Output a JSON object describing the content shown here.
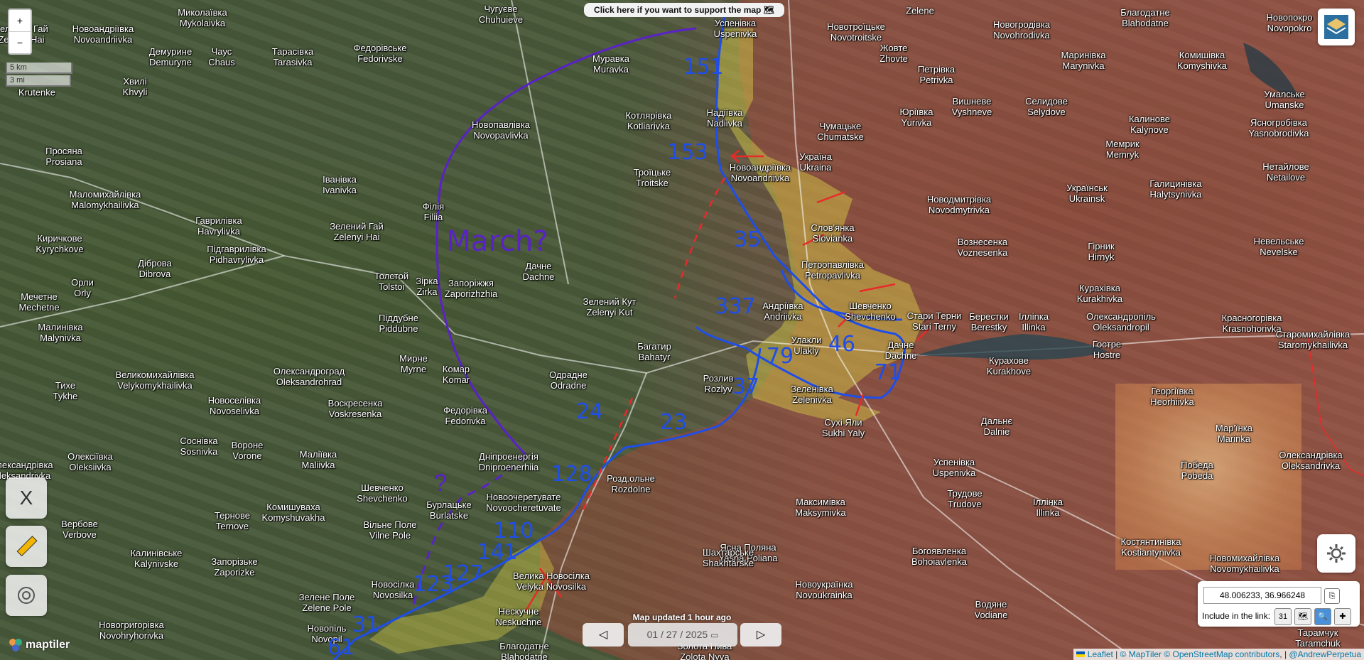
{
  "banner": {
    "support": "Click here if you want to support the map"
  },
  "zoom": {
    "in": "+",
    "out": "−"
  },
  "scale": {
    "km": "5 km",
    "mi": "3 mi"
  },
  "sidebar": {
    "x_label": "X"
  },
  "map": {
    "updated": "Map updated 1 hour ago",
    "date": "01 / 27 / 2025",
    "coordinates": "48.006233, 36.966248",
    "include_label": "Include in the link:",
    "calendar_day": "31"
  },
  "annotations": {
    "march": "March?",
    "question": "?",
    "units": [
      "151",
      "153",
      "35",
      "337",
      "79",
      "46",
      "71",
      "37",
      "23",
      "24",
      "128",
      "110",
      "141",
      "123",
      "127",
      "31",
      "61"
    ]
  },
  "attribution": {
    "leaflet": "Leaflet",
    "maptiler": "© MapTiler",
    "osm": "© OpenStreetMap contributors",
    "author": "@AndrewPerpetua",
    "logo": "maptiler"
  },
  "places": [
    [
      "Миколаївка\nMykolaivka",
      285,
      25
    ],
    [
      "Чугуєве\nChuhuieve",
      705,
      20
    ],
    [
      "Успенівка\nUspenivka",
      1035,
      40
    ],
    [
      "Новотроїцьке\nNovotroitske",
      1205,
      45
    ],
    [
      "Zelene",
      1295,
      15
    ],
    [
      "Новогродівка\nNovohrodivka",
      1438,
      42
    ],
    [
      "Благодатне\nBlahodatne",
      1612,
      25
    ],
    [
      "Новопокро\nNovopokro",
      1815,
      32
    ],
    [
      "Новоандріївка\nNovoandriivka",
      145,
      48
    ],
    [
      "Зелений Гай\nZelenyi Hai",
      30,
      48
    ],
    [
      "Демурине\nDemuryne",
      240,
      80
    ],
    [
      "Чаус\nChaus",
      312,
      80
    ],
    [
      "Тарасівка\nTarasivka",
      412,
      80
    ],
    [
      "Федорівське\nFedorivske",
      535,
      75
    ],
    [
      "Муравка\nMuravka",
      860,
      90
    ],
    [
      "Жовте\nZhovte",
      1258,
      75
    ],
    [
      "Маринівка\nMarynivka",
      1525,
      85
    ],
    [
      "Комишівка\nKomyshivka",
      1692,
      85
    ],
    [
      "Хвилі\nKhvyli",
      190,
      122
    ],
    [
      "Krutenke",
      52,
      130
    ],
    [
      "Петрівка\nPetrivka",
      1318,
      105
    ],
    [
      "Новопавлівка\nNovopavlivka",
      705,
      183
    ],
    [
      "Котлярівка\nKotliarivka",
      913,
      170
    ],
    [
      "Надіївка\nNadiivka",
      1020,
      166
    ],
    [
      "Вишневе\nVyshneve",
      1368,
      150
    ],
    [
      "Селидове\nSelydove",
      1473,
      150
    ],
    [
      "Юріївка\nYurivka",
      1290,
      165
    ],
    [
      "Калинове\nKalynove",
      1618,
      175
    ],
    [
      "Умanське\nUmanske",
      1808,
      140
    ],
    [
      "Ясногробівка\nYasnobrodivka",
      1800,
      180
    ],
    [
      "Просяна\nProsiana",
      90,
      220
    ],
    [
      "Чумацьке\nChumatske",
      1183,
      185
    ],
    [
      "Україна\nUkraina",
      1148,
      228
    ],
    [
      "Новоандріївка\nNovoandriivka",
      1070,
      243
    ],
    [
      "Троїцьке\nTroitske",
      918,
      250
    ],
    [
      "Мемрик\nMemryk",
      1580,
      210
    ],
    [
      "Маломихайлівка\nMalomykhailivka",
      148,
      281
    ],
    [
      "Іванівка\nIvanivka",
      478,
      260
    ],
    [
      "Гаврилівка\nHavrylivka",
      308,
      318
    ],
    [
      "Філія\nFiliia",
      610,
      298
    ],
    [
      "Українськ\nUkrainsk",
      1530,
      272
    ],
    [
      "Галицинівка\nHalytsynivka",
      1655,
      266
    ],
    [
      "Нетайлове\nNetailove",
      1810,
      242
    ],
    [
      "Новодмитрівка\nNovodmytrivka",
      1350,
      288
    ],
    [
      "Киричкове\nKyrychkove",
      84,
      343
    ],
    [
      "Зелений Гай\nZelenyi Hai",
      502,
      326
    ],
    [
      "Підгаврилівка\nPidhavrylivka",
      333,
      358
    ],
    [
      "Слов'янка\nSlovianka",
      1172,
      328
    ],
    [
      "Вознесенка\nVoznesenka",
      1383,
      348
    ],
    [
      "Гірник\nHirnyk",
      1550,
      354
    ],
    [
      "Невельське\nNevelske",
      1800,
      347
    ],
    [
      "Діброва\nDibrova",
      218,
      378
    ],
    [
      "Дачне\nDachne",
      758,
      382
    ],
    [
      "Петропавлівка\nPetropavlivka",
      1172,
      380
    ],
    [
      "Орли\nOrly",
      116,
      405
    ],
    [
      "Толстой\nTolstoi",
      551,
      396
    ],
    [
      "Зірка\nZirka",
      601,
      403
    ],
    [
      "Запоріжжя\nZaporizhzhia",
      663,
      406
    ],
    [
      "Зелений Кут\nZelenyi Kut",
      858,
      432
    ],
    [
      "Андріївка\nAndriivka",
      1102,
      438
    ],
    [
      "Шевченко\nShevchenko",
      1225,
      438
    ],
    [
      "Кураxівка\nKurakhivka",
      1548,
      413
    ],
    [
      "Mечетне\nMechetne",
      55,
      425
    ],
    [
      "Стари Терни\nStari Terny",
      1315,
      452
    ],
    [
      "Берестки\nBerestky",
      1392,
      453
    ],
    [
      "Ілліnка\nIllinka",
      1455,
      453
    ],
    [
      "Олександропіль\nOleksandropil",
      1578,
      453
    ],
    [
      "Красногорівка\nKrasnohorivka",
      1762,
      455
    ],
    [
      "Малинівка\nMalynivka",
      85,
      468
    ],
    [
      "Піддубне\nPiddubne",
      561,
      455
    ],
    [
      "Багатир\nBahatyr",
      921,
      495
    ],
    [
      "Улакли\nUlakly",
      1135,
      486
    ],
    [
      "Дачне\nDachne",
      1268,
      493
    ],
    [
      "Курахове\nKurakhove",
      1420,
      515
    ],
    [
      "Гостре\nHostre",
      1558,
      492
    ],
    [
      "Старомихайлівка\nStaromykhailivka",
      1848,
      478
    ],
    [
      "Мирне\nMyrne",
      582,
      512
    ],
    [
      "Комар\nKomar",
      642,
      527
    ],
    [
      "Одрадне\nOdradne",
      800,
      535
    ],
    [
      "Розлив\nRozlyv",
      1011,
      540
    ],
    [
      "Зеленівка\nZelenivka",
      1143,
      555
    ],
    [
      "Великомихайлівка\nVelykomykhailivka",
      218,
      535
    ],
    [
      "Олександроград\nOleksandrohrad",
      435,
      530
    ],
    [
      "Тихе\nTykhe",
      92,
      550
    ],
    [
      "Новоселівка\nNovoselivka",
      330,
      571
    ],
    [
      "Воскресенка\nVoskresenka",
      500,
      575
    ],
    [
      "Федорівка\nFedorivka",
      655,
      585
    ],
    [
      "Георгіївка\nHeorhiivka",
      1650,
      558
    ],
    [
      "Сухі Яли\nSukhi Yaly",
      1187,
      602
    ],
    [
      "Мар'їнка\nMarinka",
      1737,
      610
    ],
    [
      "Дальнє\nDalnie",
      1403,
      600
    ],
    [
      "Соснівка\nSosnivka",
      280,
      628
    ],
    [
      "Вороне\nVorone",
      348,
      634
    ],
    [
      "Маліївка\nMaliivka",
      448,
      647
    ],
    [
      "Дніпроенергія\nDniproenerhiia",
      716,
      650
    ],
    [
      "Олексіївка\nOleksiivka",
      127,
      650
    ],
    [
      "Олександрівка\nOleksandrivka",
      30,
      662
    ],
    [
      "Розд.ольне\nRozdolne",
      888,
      681
    ],
    [
      "Победа\nPobeda",
      1685,
      662
    ],
    [
      "Олександрівка\nOleksandrivka",
      1845,
      648
    ],
    [
      "Успенівка\nUspenivka",
      1343,
      658
    ],
    [
      "Шевченко\nShevchenko",
      538,
      694
    ],
    [
      "Бурлацьке\nBurlatske",
      632,
      718
    ],
    [
      "Новоочеретувате\nNovoocheretuvate",
      737,
      707
    ],
    [
      "Комишуваха\nKomyshuvakha",
      413,
      721
    ],
    [
      "Тернове\nTernove",
      327,
      733
    ],
    [
      "Вербове\nVerbove",
      112,
      745
    ],
    [
      "Вільне Поле\nVilne Pole",
      549,
      746
    ],
    [
      "Максимівка\nMaksymivka",
      1155,
      714
    ],
    [
      "Трудове\nTrudove",
      1358,
      702
    ],
    [
      "Іллінка\nIllinka",
      1475,
      714
    ],
    [
      "Ясна Поляна\nYasna Poliana",
      1053,
      778
    ],
    [
      "Калинівське\nKalynivske",
      220,
      786
    ],
    [
      "Запорізьке\nZaporizke",
      330,
      798
    ],
    [
      "Шахтарське\nShakhtarske",
      1025,
      785
    ],
    [
      "Богоявленка\nBohoiavlenka",
      1322,
      783
    ],
    [
      "Костянтинівка\nKostiantynivka",
      1620,
      770
    ],
    [
      "Новомихайлівка\nNovomykhailivka",
      1752,
      793
    ],
    [
      "Новосілка\nNovosilka",
      553,
      830
    ],
    [
      "Велика Новосілка\nVelyka Novosilka",
      776,
      818
    ],
    [
      "Зелене Поле\nZelene Pole",
      460,
      848
    ],
    [
      "Новоукраїнка\nNovoukrainka",
      1160,
      830
    ],
    [
      "Нескучне\nNeskuchne",
      730,
      868
    ],
    [
      "Водяне\nVodiane",
      1395,
      858
    ],
    [
      "Новогригорівка\nNovohryhorivka",
      185,
      887
    ],
    [
      "Новопіль\nNovopil",
      460,
      892
    ],
    [
      "Благодатне\nBlahodatne",
      738,
      917
    ],
    [
      "Золота Нива\nZolota Nyva",
      992,
      917
    ],
    [
      "Тарамчук\nTaramchuk",
      1855,
      898
    ]
  ]
}
